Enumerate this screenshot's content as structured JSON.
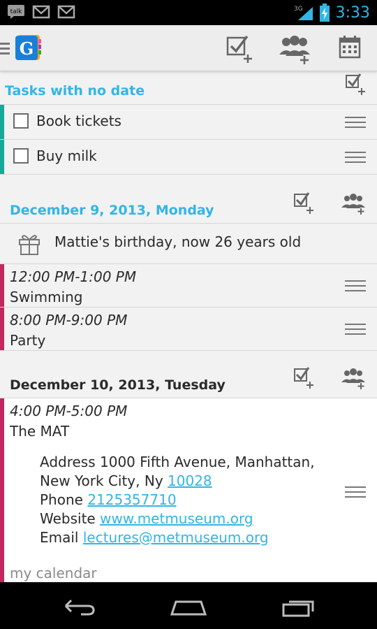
{
  "status_bar": {
    "icons": [
      "talk-icon",
      "gmail-icon",
      "gmail-icon",
      "3g-signal-icon",
      "battery-charging-icon"
    ],
    "talk_label": "talk",
    "network": "3G",
    "time": "3:33"
  },
  "action_bar": {
    "logo_letter": "G",
    "buttons": [
      "add-task-icon",
      "add-contact-icon",
      "calendar-icon"
    ]
  },
  "tasks_section": {
    "title": "Tasks with no date",
    "tasks": [
      {
        "label": "Book tickets",
        "checked": false
      },
      {
        "label": "Buy milk",
        "checked": false
      }
    ]
  },
  "day1": {
    "title": "December 9, 2013, Monday",
    "birthday": "Mattie's birthday, now 26 years old",
    "events": [
      {
        "time": "12:00 PM-1:00 PM",
        "title": "Swimming"
      },
      {
        "time": "8:00 PM-9:00 PM",
        "title": "Party"
      }
    ]
  },
  "day2": {
    "title": "December 10, 2013, Tuesday",
    "event": {
      "time": "4:00 PM-5:00 PM",
      "title": "The MAT",
      "address_label": "Address 1000 Fifth Avenue, Manhattan,",
      "address_line2": "New York City, Ny ",
      "zip": "10028",
      "phone_label": "Phone ",
      "phone": "2125357710",
      "website_label": "Website ",
      "website": "www.metmuseum.org",
      "email_label": "Email ",
      "email": "lectures@metmuseum.org",
      "calendar": "my calendar"
    }
  },
  "colors": {
    "accent": "#33b5e5",
    "task_bar": "#16a89b",
    "event_bar": "#c2285f"
  },
  "nav_bar": {
    "buttons": [
      "back-icon",
      "home-icon",
      "recent-apps-icon"
    ]
  }
}
